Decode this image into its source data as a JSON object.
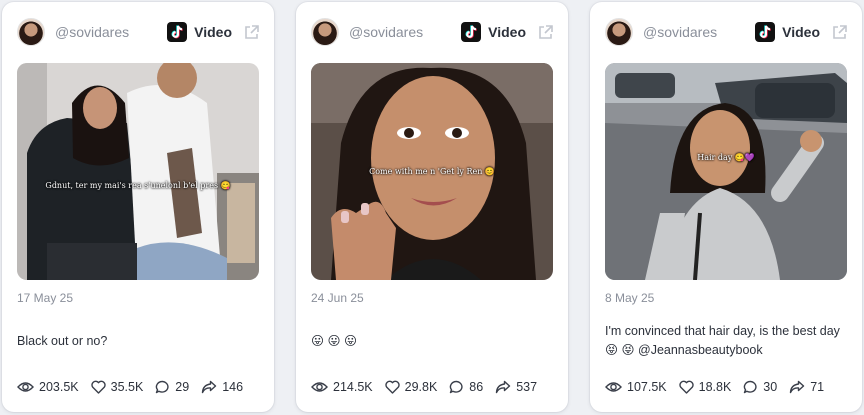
{
  "posts": [
    {
      "handle": "@sovidares",
      "platform_label": "Video",
      "overlay_text": "Gdnut, ter my mai's rea s'unelonl b'el pres 😋",
      "date": "17 May 25",
      "caption": "Black out or no?",
      "views": "203.5K",
      "likes": "35.5K",
      "comments": "29",
      "shares": "146"
    },
    {
      "handle": "@sovidares",
      "platform_label": "Video",
      "overlay_text": "Come with me n 'Get ly Ren 😊",
      "date": "24 Jun 25",
      "caption": "😛 😛 😛",
      "views": "214.5K",
      "likes": "29.8K",
      "comments": "86",
      "shares": "537"
    },
    {
      "handle": "@sovidares",
      "platform_label": "Video",
      "overlay_text": "Hair day 😋💜",
      "date": "8 May 25",
      "caption": "I'm convinced that hair day, is the best day 😝 😝 @Jeannasbeautybook",
      "views": "107.5K",
      "likes": "18.8K",
      "comments": "30",
      "shares": "71"
    }
  ],
  "icons": {
    "platform": "tiktok-icon",
    "external": "external-link-icon",
    "views": "eye-icon",
    "likes": "heart-icon",
    "comments": "comment-icon",
    "shares": "share-icon"
  },
  "colors": {
    "background": "#eef0f4",
    "card": "#ffffff",
    "muted_text": "#8a8f9a",
    "text": "#2c313b"
  }
}
